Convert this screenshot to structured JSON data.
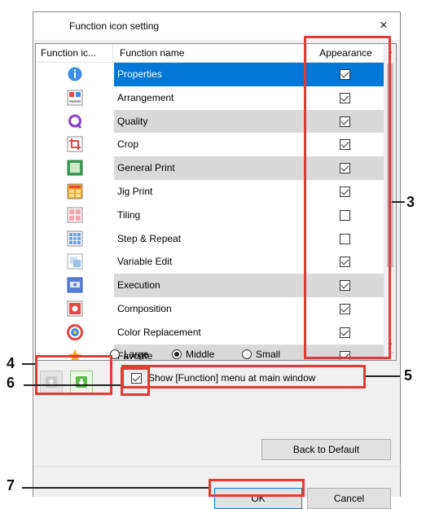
{
  "dialog": {
    "title": "Function icon setting",
    "close_glyph": "×"
  },
  "table": {
    "columns": [
      "Function ic...",
      "Function name",
      "Appearance"
    ],
    "rows": [
      {
        "icon": "info-icon",
        "name": "Properties",
        "checked": true,
        "style": "selected"
      },
      {
        "icon": "arrangement-icon",
        "name": "Arrangement",
        "checked": true,
        "style": "white"
      },
      {
        "icon": "quality-icon",
        "name": "Quality",
        "checked": true,
        "style": "gray"
      },
      {
        "icon": "crop-icon",
        "name": "Crop",
        "checked": true,
        "style": "white"
      },
      {
        "icon": "general-print-icon",
        "name": "General Print",
        "checked": true,
        "style": "gray"
      },
      {
        "icon": "jig-print-icon",
        "name": "Jig Print",
        "checked": true,
        "style": "white"
      },
      {
        "icon": "tiling-icon",
        "name": "Tiling",
        "checked": false,
        "style": "white"
      },
      {
        "icon": "step-repeat-icon",
        "name": "Step & Repeat",
        "checked": false,
        "style": "white"
      },
      {
        "icon": "variable-edit-icon",
        "name": "Variable Edit",
        "checked": true,
        "style": "white"
      },
      {
        "icon": "execution-icon",
        "name": "Execution",
        "checked": true,
        "style": "gray"
      },
      {
        "icon": "composition-icon",
        "name": "Composition",
        "checked": true,
        "style": "white"
      },
      {
        "icon": "color-replacement-icon",
        "name": "Color Replacement",
        "checked": true,
        "style": "white"
      },
      {
        "icon": "favorite-icon",
        "name": "Favorite",
        "checked": true,
        "style": "gray"
      }
    ]
  },
  "size_options": {
    "options": [
      "Large",
      "Middle",
      "Small"
    ],
    "selected": "Middle"
  },
  "show_menu": {
    "label": "Show [Function] menu at main window",
    "checked": true
  },
  "buttons": {
    "back_to_default": "Back to Default",
    "ok": "OK",
    "cancel": "Cancel"
  },
  "callouts": {
    "n3": "3",
    "n4": "4",
    "n5": "5",
    "n6": "6",
    "n7": "7",
    "color": "#e53935"
  },
  "colors": {
    "selection": "#0078d7",
    "gray_row": "#d9d9d9"
  }
}
